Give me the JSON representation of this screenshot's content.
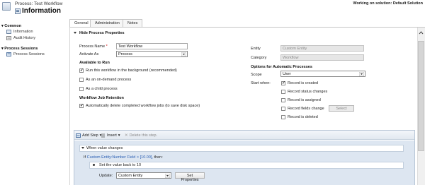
{
  "header": {
    "subtitle": "Process: Test Workflow",
    "title": "Information",
    "solution": "Working on solution: Default Solution"
  },
  "nav": {
    "common_label": "Common",
    "common_items": [
      "Information",
      "Audit History"
    ],
    "sessions_label": "Process Sessions",
    "sessions_items": [
      "Process Sessions"
    ]
  },
  "tabs": [
    "General",
    "Administration",
    "Notes"
  ],
  "section": {
    "title": "Hide Process Properties"
  },
  "left": {
    "process_name_label": "Process Name",
    "required_mark": "*",
    "process_name_value": "Test Workflow",
    "activate_as_label": "Activate As",
    "activate_as_value": "Process",
    "available_title": "Available to Run",
    "available_options": [
      {
        "label": "Run this workflow in the background (recommended)",
        "checked": true
      },
      {
        "label": "As an on-demand process",
        "checked": false
      },
      {
        "label": "As a child process",
        "checked": false
      }
    ],
    "retention_title": "Workflow Job Retention",
    "retention_option": {
      "label": "Automatically delete completed workflow jobs (to save disk space)",
      "checked": true
    }
  },
  "right": {
    "entity_label": "Entity",
    "entity_value": "Custom Entity",
    "category_label": "Category",
    "category_value": "Workflow",
    "options_title": "Options for Automatic Processes",
    "scope_label": "Scope",
    "scope_value": "User",
    "start_when_label": "Start when:",
    "start_options": [
      {
        "label": "Record is created",
        "checked": true
      },
      {
        "label": "Record status changes",
        "checked": false
      },
      {
        "label": "Record is assigned",
        "checked": false
      },
      {
        "label": "Record fields change",
        "checked": false
      },
      {
        "label": "Record is deleted",
        "checked": false
      }
    ],
    "select_button": "Select"
  },
  "designer": {
    "add_step": "Add Step",
    "insert": "Insert",
    "delete": "Delete this step.",
    "step_text": "When value changes",
    "cond_prefix": "If",
    "cond_link": "Custom Entity:Number Field > [10.00],",
    "cond_suffix": "then:",
    "inner_text": "Set the value back to 10",
    "update_label": "Update:",
    "update_value": "Custom Entity",
    "set_properties": "Set Properties"
  },
  "colors": {
    "link": "#2b5fb3",
    "required": "#cc0000",
    "canvas": "#dde6f1"
  }
}
